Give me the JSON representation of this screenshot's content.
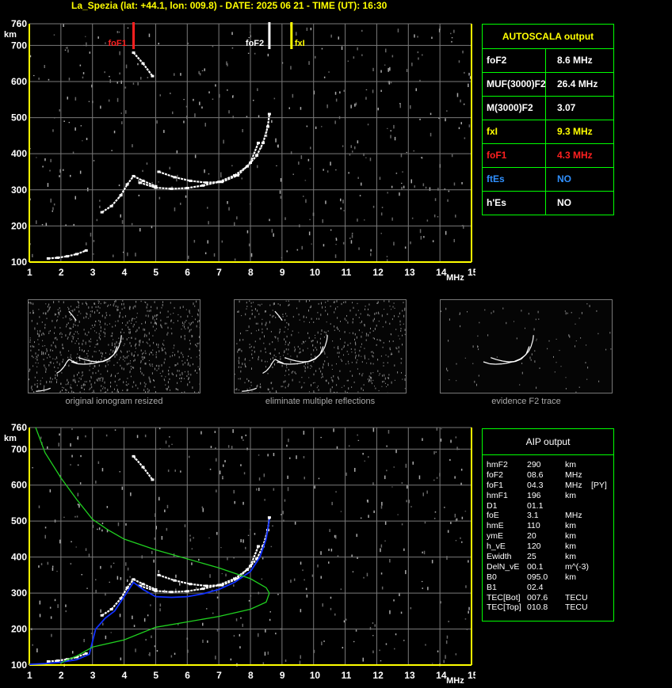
{
  "header": {
    "title": "La_Spezia (lat: +44.1, lon: 009.8) - DATE: 2025 06 21 - TIME (UT): 16:30"
  },
  "colors": {
    "axis": "#ffff00",
    "foF1": "#ff2020",
    "fxI": "#ffff00",
    "foF2": "#ffffff",
    "trace": "#ffffff",
    "model_trace": "#1030ff",
    "profile": "#20d020",
    "table_border": "#00ff00",
    "label_blue": "#3090ff"
  },
  "autoscala": {
    "title": "AUTOSCALA output",
    "rows": [
      {
        "key": "foF2",
        "value": "8.6 MHz",
        "color": "#ffffff"
      },
      {
        "key": "MUF(3000)F2",
        "value": "26.4 MHz",
        "color": "#ffffff"
      },
      {
        "key": "M(3000)F2",
        "value": "3.07",
        "color": "#ffffff"
      },
      {
        "key": "fxI",
        "value": "9.3 MHz",
        "color": "#ffff00"
      },
      {
        "key": "foF1",
        "value": "4.3 MHz",
        "color": "#ff2020"
      },
      {
        "key": "ftEs",
        "value": "NO",
        "color": "#3090ff"
      },
      {
        "key": "h'Es",
        "value": "NO",
        "color": "#ffffff"
      }
    ]
  },
  "markers": {
    "foF1": "foF1",
    "foF2": "foF2",
    "fxI": "fxI"
  },
  "thumbnails": [
    {
      "caption": "original ionogram resized"
    },
    {
      "caption": "eliminate multiple reflections"
    },
    {
      "caption": "evidence F2 trace"
    }
  ],
  "aip": {
    "title": "AIP output",
    "rows": [
      {
        "name": "hmF2",
        "value": "290",
        "unit": "km",
        "note": ""
      },
      {
        "name": "foF2",
        "value": "08.6",
        "unit": "MHz",
        "note": ""
      },
      {
        "name": "foF1",
        "value": "04.3",
        "unit": "MHz",
        "note": "[PY]"
      },
      {
        "name": "hmF1",
        "value": "196",
        "unit": "km",
        "note": ""
      },
      {
        "name": "D1",
        "value": "01.1",
        "unit": "",
        "note": ""
      },
      {
        "name": "foE",
        "value": "3.1",
        "unit": "MHz",
        "note": ""
      },
      {
        "name": "hmE",
        "value": "110",
        "unit": "km",
        "note": ""
      },
      {
        "name": "ymE",
        "value": "20",
        "unit": "km",
        "note": ""
      },
      {
        "name": "h_vE",
        "value": "120",
        "unit": "km",
        "note": ""
      },
      {
        "name": "Ewidth",
        "value": "25",
        "unit": "km",
        "note": ""
      },
      {
        "name": "DelN_vE",
        "value": "00.1",
        "unit": "m^(-3)",
        "note": ""
      },
      {
        "name": "B0",
        "value": "095.0",
        "unit": "km",
        "note": ""
      },
      {
        "name": "B1",
        "value": "02.4",
        "unit": "",
        "note": ""
      },
      {
        "name": "TEC[Bot]",
        "value": "007.6",
        "unit": "TECU",
        "note": ""
      },
      {
        "name": "TEC[Top]",
        "value": "010.8",
        "unit": "TECU",
        "note": ""
      }
    ]
  },
  "chart_data": [
    {
      "type": "scatter",
      "title": "",
      "xlabel": "MHz",
      "ylabel": "km",
      "xlim": [
        1,
        15
      ],
      "ylim": [
        100,
        760
      ],
      "x_ticks": [
        1,
        2,
        3,
        4,
        5,
        6,
        7,
        8,
        9,
        10,
        11,
        12,
        13,
        14,
        15
      ],
      "y_ticks": [
        100,
        200,
        300,
        400,
        500,
        600,
        700,
        760
      ],
      "grid": true,
      "series": [
        {
          "kind": "trace_E",
          "color": "#ffffff",
          "x": [
            1.6,
            1.9,
            2.2,
            2.5,
            2.8
          ],
          "y": [
            110,
            112,
            116,
            122,
            132
          ]
        },
        {
          "kind": "trace_F1",
          "color": "#ffffff",
          "x": [
            3.3,
            3.6,
            3.9,
            4.1,
            4.3,
            4.6,
            5.0
          ],
          "y": [
            238,
            255,
            285,
            315,
            338,
            325,
            310
          ]
        },
        {
          "kind": "trace_F2_o",
          "color": "#ffffff",
          "x": [
            4.5,
            5.0,
            5.5,
            6.0,
            6.5,
            7.0,
            7.5,
            7.9,
            8.2,
            8.4,
            8.55,
            8.6
          ],
          "y": [
            320,
            306,
            303,
            305,
            312,
            322,
            340,
            365,
            395,
            430,
            475,
            510
          ]
        },
        {
          "kind": "trace_F2_x",
          "color": "#ffffff",
          "x": [
            5.1,
            5.6,
            6.1,
            6.6,
            7.1,
            7.6,
            8.0,
            8.25
          ],
          "y": [
            350,
            335,
            325,
            320,
            322,
            340,
            375,
            430
          ]
        },
        {
          "kind": "fragment",
          "color": "#ffffff",
          "x": [
            4.3,
            4.6,
            4.9
          ],
          "y": [
            680,
            650,
            615
          ]
        }
      ]
    },
    {
      "type": "line",
      "title": "",
      "xlabel": "MHz",
      "ylabel": "km",
      "xlim": [
        1,
        15
      ],
      "ylim": [
        100,
        760
      ],
      "x_ticks": [
        1,
        2,
        3,
        4,
        5,
        6,
        7,
        8,
        9,
        10,
        11,
        12,
        13,
        14,
        15
      ],
      "y_ticks": [
        100,
        200,
        300,
        400,
        500,
        600,
        700,
        760
      ],
      "grid": true,
      "series": [
        {
          "kind": "trace_E",
          "color": "#ffffff",
          "x": [
            1.6,
            1.9,
            2.2,
            2.5,
            2.8
          ],
          "y": [
            110,
            112,
            116,
            122,
            132
          ]
        },
        {
          "kind": "trace_F1",
          "color": "#ffffff",
          "x": [
            3.3,
            3.6,
            3.9,
            4.1,
            4.3,
            4.6,
            5.0
          ],
          "y": [
            238,
            255,
            285,
            315,
            338,
            325,
            310
          ]
        },
        {
          "kind": "trace_F2_o",
          "color": "#ffffff",
          "x": [
            4.5,
            5.0,
            5.5,
            6.0,
            6.5,
            7.0,
            7.5,
            7.9,
            8.2,
            8.4,
            8.55,
            8.6
          ],
          "y": [
            320,
            306,
            303,
            305,
            312,
            322,
            340,
            365,
            395,
            430,
            475,
            510
          ]
        },
        {
          "kind": "trace_F2_x",
          "color": "#ffffff",
          "x": [
            5.1,
            5.6,
            6.1,
            6.6,
            7.1,
            7.6,
            8.0,
            8.25
          ],
          "y": [
            350,
            335,
            325,
            320,
            322,
            340,
            375,
            430
          ]
        },
        {
          "kind": "fragment",
          "color": "#ffffff",
          "x": [
            4.3,
            4.6,
            4.9
          ],
          "y": [
            680,
            650,
            615
          ]
        },
        {
          "kind": "model_trace",
          "color": "#1030ff",
          "x": [
            1.0,
            1.5,
            2.0,
            2.5,
            2.9,
            3.1,
            3.4,
            3.7,
            4.0,
            4.3,
            4.6,
            5.0,
            5.5,
            6.0,
            6.5,
            7.0,
            7.5,
            8.0,
            8.3,
            8.5,
            8.6
          ],
          "y": [
            102,
            104,
            108,
            115,
            130,
            200,
            230,
            250,
            290,
            330,
            310,
            290,
            288,
            290,
            298,
            310,
            330,
            360,
            400,
            450,
            505
          ]
        },
        {
          "kind": "profile",
          "color": "#20d020",
          "x": [
            1.2,
            1.5,
            2.0,
            2.5,
            3.0,
            3.5,
            4.0,
            5.0,
            6.0,
            7.0,
            8.0,
            8.5,
            8.6,
            8.5,
            8.0,
            7.0,
            6.0,
            5.0,
            4.0,
            3.0,
            2.5,
            2.2,
            2.0
          ],
          "y": [
            760,
            690,
            620,
            560,
            505,
            475,
            450,
            420,
            395,
            370,
            340,
            315,
            300,
            275,
            255,
            235,
            220,
            205,
            170,
            150,
            125,
            115,
            105
          ]
        }
      ]
    }
  ]
}
